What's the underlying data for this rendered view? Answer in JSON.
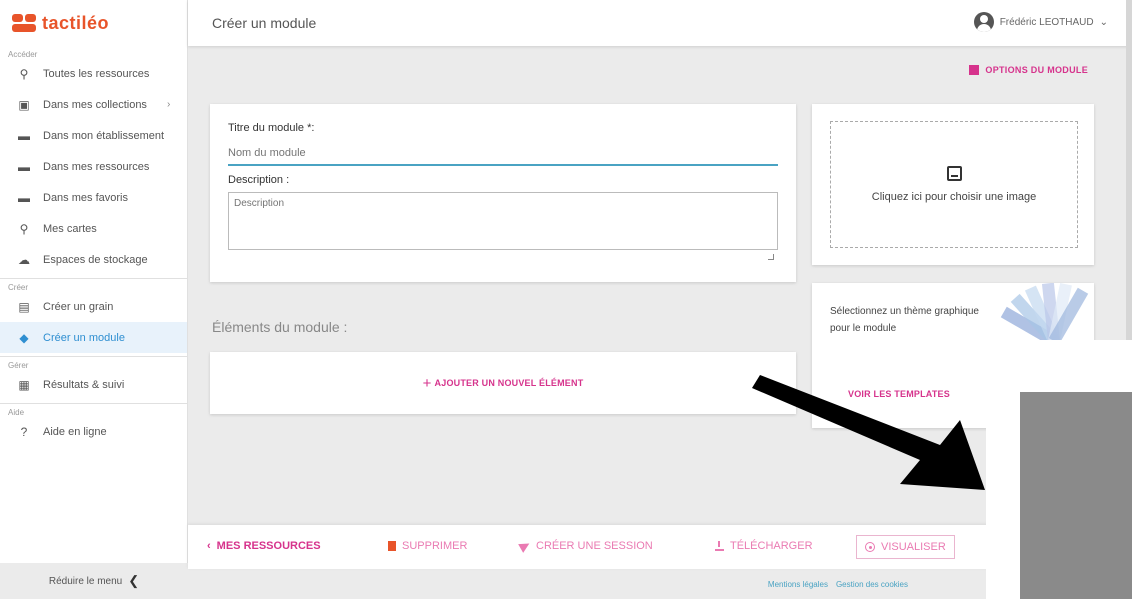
{
  "app": {
    "logo": "tactiléo",
    "page_title": "Créer un module"
  },
  "user": {
    "name": "Frédéric LEOTHAUD",
    "caret": "⌄"
  },
  "sidebar": {
    "sections": [
      {
        "label": "Accéder",
        "items": [
          {
            "label": "Toutes les ressources",
            "icon": "search-icon",
            "glyph": "⚲"
          },
          {
            "label": "Dans mes collections",
            "icon": "collections-icon",
            "glyph": "▣",
            "chevron": "›"
          },
          {
            "label": "Dans mon établissement",
            "icon": "school-folder-icon",
            "glyph": "▬"
          },
          {
            "label": "Dans mes ressources",
            "icon": "folder-icon",
            "glyph": "▬"
          },
          {
            "label": "Dans mes favoris",
            "icon": "favorite-folder-icon",
            "glyph": "▬"
          },
          {
            "label": "Mes cartes",
            "icon": "map-pin-icon",
            "glyph": "⚲"
          },
          {
            "label": "Espaces de stockage",
            "icon": "cloud-icon",
            "glyph": "☁"
          }
        ]
      },
      {
        "label": "Créer",
        "items": [
          {
            "label": "Créer un grain",
            "icon": "grain-icon",
            "glyph": "▤"
          },
          {
            "label": "Créer un module",
            "icon": "module-icon",
            "glyph": "◆",
            "active": true
          }
        ]
      },
      {
        "label": "Gérer",
        "items": [
          {
            "label": "Résultats & suivi",
            "icon": "results-icon",
            "glyph": "▦"
          }
        ]
      },
      {
        "label": "Aide",
        "items": [
          {
            "label": "Aide en ligne",
            "icon": "help-icon",
            "glyph": "?"
          }
        ]
      }
    ],
    "collapse_label": "Réduire le menu",
    "collapse_arrow": "❮"
  },
  "options_label": "OPTIONS DU MODULE",
  "form": {
    "title_label": "Titre du module *:",
    "title_placeholder": "Nom du module",
    "description_label": "Description :",
    "description_placeholder": "Description"
  },
  "image_card": {
    "text": "Cliquez ici pour choisir une image"
  },
  "theme_card": {
    "text": "Sélectionnez un thème graphique pour le module",
    "button": "VOIR LES TEMPLATES",
    "swatch_colors": [
      "#8fa8d8",
      "#a7c4e6",
      "#c3d8ef",
      "#b9c6e8",
      "#dfe9f6",
      "#9bb5dd"
    ]
  },
  "elements": {
    "title": "Éléments du module :",
    "add_label": "AJOUTER UN NOUVEL ÉLÉMENT",
    "add_plus": "+"
  },
  "actions": {
    "back": "MES RESSOURCES",
    "back_glyph": "‹",
    "delete": "SUPPRIMER",
    "session": "CRÉER UNE SESSION",
    "download": "TÉLÉCHARGER",
    "preview": "VISUALISER"
  },
  "footer": {
    "legal": "Mentions légales",
    "cookies": "Gestion des cookies"
  },
  "colors": {
    "accent": "#d6338c",
    "brand": "#e8542a",
    "link": "#4aa3c3",
    "active": "#2f8fd1"
  }
}
